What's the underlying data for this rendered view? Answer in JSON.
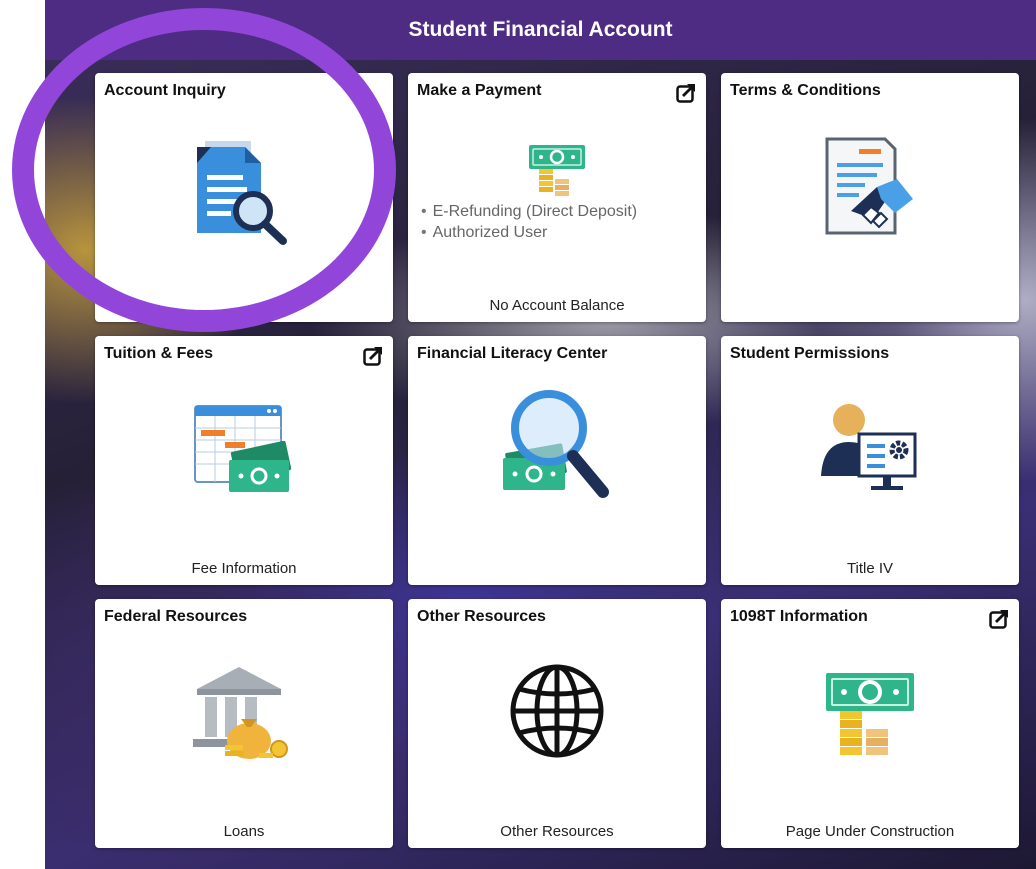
{
  "header": {
    "title": "Student Financial Account"
  },
  "tiles": {
    "account_inquiry": {
      "title": "Account Inquiry",
      "icon": "document-search-icon"
    },
    "make_payment": {
      "title": "Make a Payment",
      "icon": "money-coins-icon",
      "bullets": [
        "E-Refunding (Direct Deposit)",
        "Authorized User"
      ],
      "footer": "No Account Balance",
      "external": true
    },
    "terms": {
      "title": "Terms & Conditions",
      "icon": "contract-handshake-icon"
    },
    "tuition": {
      "title": "Tuition & Fees",
      "icon": "calendar-money-icon",
      "footer": "Fee Information",
      "external": true
    },
    "literacy": {
      "title": "Financial Literacy Center",
      "icon": "money-magnifier-icon"
    },
    "permissions": {
      "title": "Student Permissions",
      "icon": "user-monitor-gear-icon",
      "footer": "Title IV"
    },
    "federal": {
      "title": "Federal Resources",
      "icon": "bank-moneybag-icon",
      "footer": "Loans"
    },
    "other": {
      "title": "Other Resources",
      "icon": "globe-icon",
      "footer": "Other Resources"
    },
    "t1098": {
      "title": "1098T Information",
      "icon": "money-coins-icon",
      "footer": "Page Under Construction",
      "external": true
    }
  },
  "colors": {
    "header": "#4f2c83",
    "highlight_circle": "#9146d9",
    "money_green": "#2fb58a",
    "coin_gold": "#f3c530",
    "doc_blue": "#3a8fdc"
  }
}
